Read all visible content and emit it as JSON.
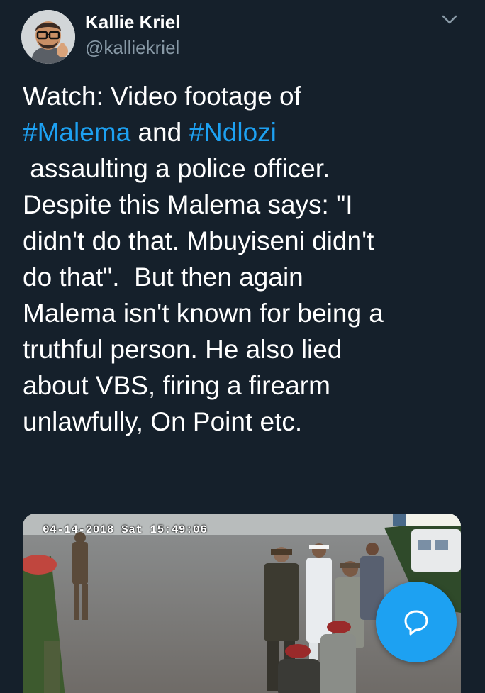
{
  "author": {
    "name": "Kallie Kriel",
    "handle": "@kalliekriel",
    "avatar_icon": "memoji-avatar-icon"
  },
  "menu_icon": "chevron-down-icon",
  "tweet": {
    "lines": [
      [
        {
          "text": "Watch: Video footage of",
          "type": "text"
        }
      ],
      [
        {
          "text": "#Malema",
          "type": "hashtag"
        },
        {
          "text": " and ",
          "type": "text"
        },
        {
          "text": "#Ndlozi",
          "type": "hashtag"
        }
      ],
      [
        {
          "text": " assaulting a police officer.",
          "type": "text"
        }
      ],
      [
        {
          "text": "Despite this Malema says: \"I",
          "type": "text"
        }
      ],
      [
        {
          "text": "didn't do that. Mbuyiseni didn't",
          "type": "text"
        }
      ],
      [
        {
          "text": "do that\".  But then again",
          "type": "text"
        }
      ],
      [
        {
          "text": "Malema isn't known for being a",
          "type": "text"
        }
      ],
      [
        {
          "text": "truthful person. He also lied",
          "type": "text"
        }
      ],
      [
        {
          "text": "about VBS, firing a firearm",
          "type": "text"
        }
      ],
      [
        {
          "text": "unlawfully, On Point etc.",
          "type": "text"
        }
      ]
    ]
  },
  "media": {
    "timestamp": "04-14-2018 Sat 15:49:06",
    "icon": "video-frame-icon"
  },
  "compose_button": {
    "icon": "speech-bubble-icon"
  },
  "colors": {
    "background": "#15202b",
    "hashtag": "#1da1f2",
    "secondary_text": "#8899a6",
    "fab": "#1da1f2"
  }
}
